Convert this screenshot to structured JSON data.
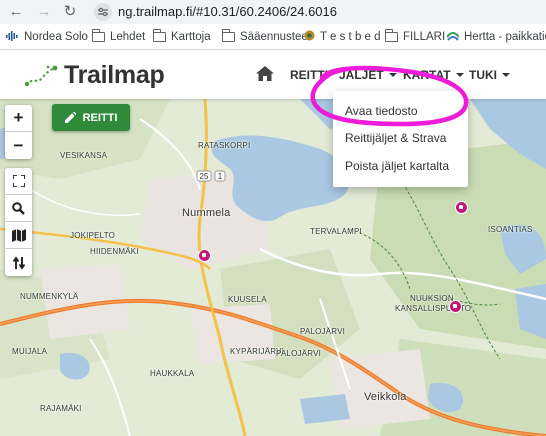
{
  "browser": {
    "url": "ng.trailmap.fi/#10.31/60.2406/24.6016",
    "back_icon": "arrow-left-icon",
    "forward_icon": "arrow-right-icon",
    "reload_icon": "reload-icon",
    "bookmarks": [
      {
        "label": "Nordea Solo",
        "icon": "nordea-icon"
      },
      {
        "label": "Lehdet",
        "icon": "folder-icon"
      },
      {
        "label": "Karttoja",
        "icon": "folder-icon"
      },
      {
        "label": "Sääennusteet",
        "icon": "folder-icon"
      },
      {
        "label": "T e s t b e d",
        "icon": "testbed-icon"
      },
      {
        "label": "FILLARI",
        "icon": "folder-icon"
      },
      {
        "label": "Hertta - paikkatieto...",
        "icon": "hertta-icon"
      }
    ]
  },
  "site": {
    "logo_text": "Trailmap",
    "nav": [
      {
        "label": "REITTI"
      },
      {
        "label": "JÄLJET"
      },
      {
        "label": "KARTAT"
      },
      {
        "label": "TUKI"
      }
    ],
    "dropdown": [
      {
        "label": "Avaa tiedosto"
      },
      {
        "label": "Reittijäljet & Strava"
      },
      {
        "label": "Poista jäljet kartalta"
      }
    ]
  },
  "map": {
    "reitti_button": "REITTI",
    "controls": [
      "+",
      "−"
    ],
    "labels": {
      "nummela": "Nummela",
      "vesikansa": "VESIKANSA",
      "rataskorpi": "RATASKORPI",
      "jokipelto": "JOKIPELTO",
      "hiidenmaki": "HIIDENMÄKI",
      "numminkyla": "NUMMENKYLÄ",
      "kuusela": "KUUSELA",
      "paloaarni": "PALOJÄRVI",
      "nuuksion": "NUUKSION",
      "kansallispuisto": "KANSALLISPUISTO",
      "tervalampi": "TERVALAMPI",
      "isoantias": "ISOANTIAS",
      "veikkola": "Veikkola",
      "muijala": "MUIJALA",
      "kyparijarvi": "KYPÄRIJÄRVI",
      "palojarvi2": "PALOJÄRVI",
      "haukkala": "HAUKKALA",
      "rajamaki": "RAJAMÄKI",
      "road_25": "25",
      "road_1": "1"
    }
  }
}
